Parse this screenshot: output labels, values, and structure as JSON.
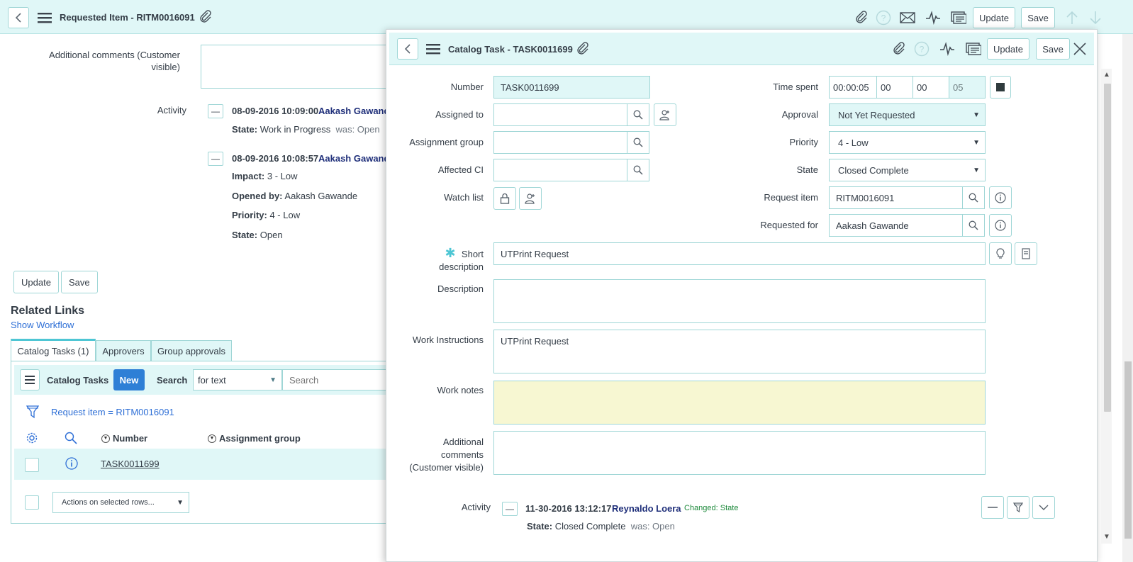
{
  "main_header": {
    "title": "Requested Item - RITM0016091",
    "update_label": "Update",
    "save_label": "Save"
  },
  "main_form": {
    "additional_comments_label": "Additional comments (Customer visible)",
    "activity_label": "Activity",
    "activity": [
      {
        "time": "08-09-2016 10:09:00",
        "user": "Aakash Gawande",
        "lines": [
          {
            "key": "State:",
            "value": "Work in Progress",
            "was": "was: Open"
          }
        ]
      },
      {
        "time": "08-09-2016 10:08:57",
        "user": "Aakash Gawande",
        "lines": [
          {
            "key": "Impact:",
            "value": "3 - Low",
            "was": ""
          },
          {
            "key": "Opened by:",
            "value": "Aakash Gawande",
            "was": ""
          },
          {
            "key": "Priority:",
            "value": "4 - Low",
            "was": ""
          },
          {
            "key": "State:",
            "value": "Open",
            "was": ""
          }
        ]
      }
    ],
    "update_label": "Update",
    "save_label": "Save"
  },
  "related_links": {
    "title": "Related Links",
    "show_workflow": "Show Workflow"
  },
  "tabs": [
    {
      "label": "Catalog Tasks (1)",
      "active": true
    },
    {
      "label": "Approvers",
      "active": false
    },
    {
      "label": "Group approvals",
      "active": false
    }
  ],
  "list": {
    "title": "Catalog Tasks",
    "new_label": "New",
    "search_label": "Search",
    "search_mode": "for text",
    "search_placeholder": "Search",
    "filter_text": "Request item = RITM0016091",
    "columns": [
      "Number",
      "Assignment group"
    ],
    "rows": [
      {
        "number": "TASK0011699",
        "assignment_group": ""
      }
    ],
    "actions_label": "Actions on selected rows..."
  },
  "dialog": {
    "title": "Catalog Task - TASK0011699",
    "update_label": "Update",
    "save_label": "Save",
    "fields": {
      "number_label": "Number",
      "number_value": "TASK0011699",
      "assigned_to_label": "Assigned to",
      "assigned_to_value": "",
      "assignment_group_label": "Assignment group",
      "assignment_group_value": "",
      "affected_ci_label": "Affected CI",
      "affected_ci_value": "",
      "watch_list_label": "Watch list",
      "time_spent_label": "Time spent",
      "time_spent_total": "00:00:05",
      "time_spent_hours": "00",
      "time_spent_minutes": "00",
      "time_spent_seconds": "05",
      "approval_label": "Approval",
      "approval_value": "Not Yet Requested",
      "priority_label": "Priority",
      "priority_value": "4 - Low",
      "state_label": "State",
      "state_value": "Closed Complete",
      "request_item_label": "Request item",
      "request_item_value": "RITM0016091",
      "requested_for_label": "Requested for",
      "requested_for_value": "Aakash Gawande",
      "short_description_label": "Short description",
      "short_description_value": "UTPrint Request",
      "description_label": "Description",
      "description_value": "",
      "work_instructions_label": "Work Instructions",
      "work_instructions_value": "UTPrint Request",
      "work_notes_label": "Work notes",
      "work_notes_value": "",
      "additional_comments_label": "Additional comments (Customer visible)",
      "additional_comments_value": ""
    },
    "activity_label": "Activity",
    "activity": {
      "time": "11-30-2016 13:12:17",
      "user": "Reynaldo Loera",
      "changed_label": "Changed:",
      "changed_field": "State",
      "line_key": "State:",
      "line_value": "Closed Complete",
      "line_was": "was: Open"
    }
  },
  "icons": {
    "back": "chevron-left-icon",
    "menu": "hamburger-icon",
    "attachment": "paperclip-icon",
    "help": "question-icon",
    "email": "envelope-icon",
    "activity": "pulse-icon",
    "templates": "template-icon",
    "close": "close-icon"
  },
  "colors": {
    "header_bg": "#e0f7f7",
    "border": "#9fd6d6",
    "link": "#2e6fd6",
    "user_name": "#1f2f7a",
    "work_notes_bg": "#f7f7d2",
    "new_button": "#2e7fd6"
  }
}
